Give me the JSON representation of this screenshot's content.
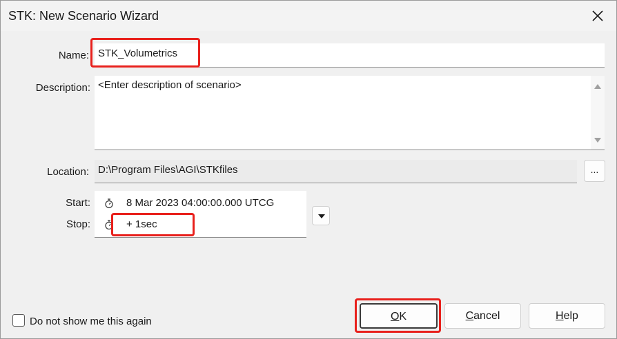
{
  "window": {
    "title": "STK: New Scenario Wizard",
    "close_icon": "close-icon"
  },
  "form": {
    "name_label": "Name:",
    "name_value": "STK_Volumetrics",
    "description_label": "Description:",
    "description_value": "<Enter description of scenario>",
    "location_label": "Location:",
    "location_value": "D:\\Program Files\\AGI\\STKfiles",
    "browse_label": "...",
    "start_label": "Start:",
    "start_value": "8 Mar 2023 04:00:00.000 UTCG",
    "stop_label": "Stop:",
    "stop_value": "+ 1sec"
  },
  "footer": {
    "checkbox_label": "Do not show me this again",
    "checkbox_checked": false,
    "ok_label": "OK",
    "cancel_label": "Cancel",
    "help_label": "Help"
  },
  "colors": {
    "highlight": "#e8201c",
    "window_bg": "#f0f0f0"
  }
}
